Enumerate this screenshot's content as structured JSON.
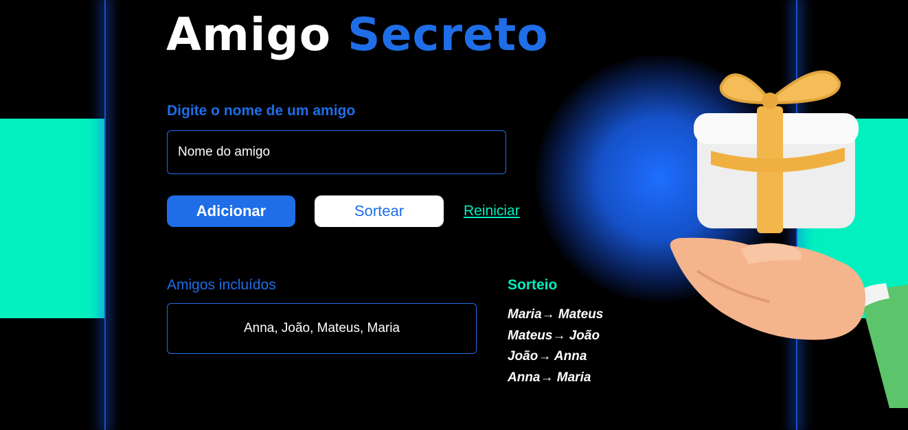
{
  "header": {
    "title_part1": "Amigo",
    "title_part2": "Secreto"
  },
  "form": {
    "label": "Digite o nome de um amigo",
    "input_placeholder": "Nome do amigo",
    "input_value": ""
  },
  "actions": {
    "add_label": "Adicionar",
    "draw_label": "Sortear",
    "reset_label": "Reiniciar"
  },
  "friends": {
    "heading": "Amigos incluídos",
    "list_text": "Anna, João, Mateus, Maria"
  },
  "draw": {
    "heading": "Sorteio",
    "results": [
      "Maria→ Mateus",
      "Mateus→ João",
      "João→ Anna",
      "Anna→ Maria"
    ]
  },
  "colors": {
    "background": "#000000",
    "accent_blue": "#1f6ee8",
    "accent_teal": "#00f0c0",
    "text": "#ffffff"
  },
  "illustration": "gift-on-hand-illustration"
}
